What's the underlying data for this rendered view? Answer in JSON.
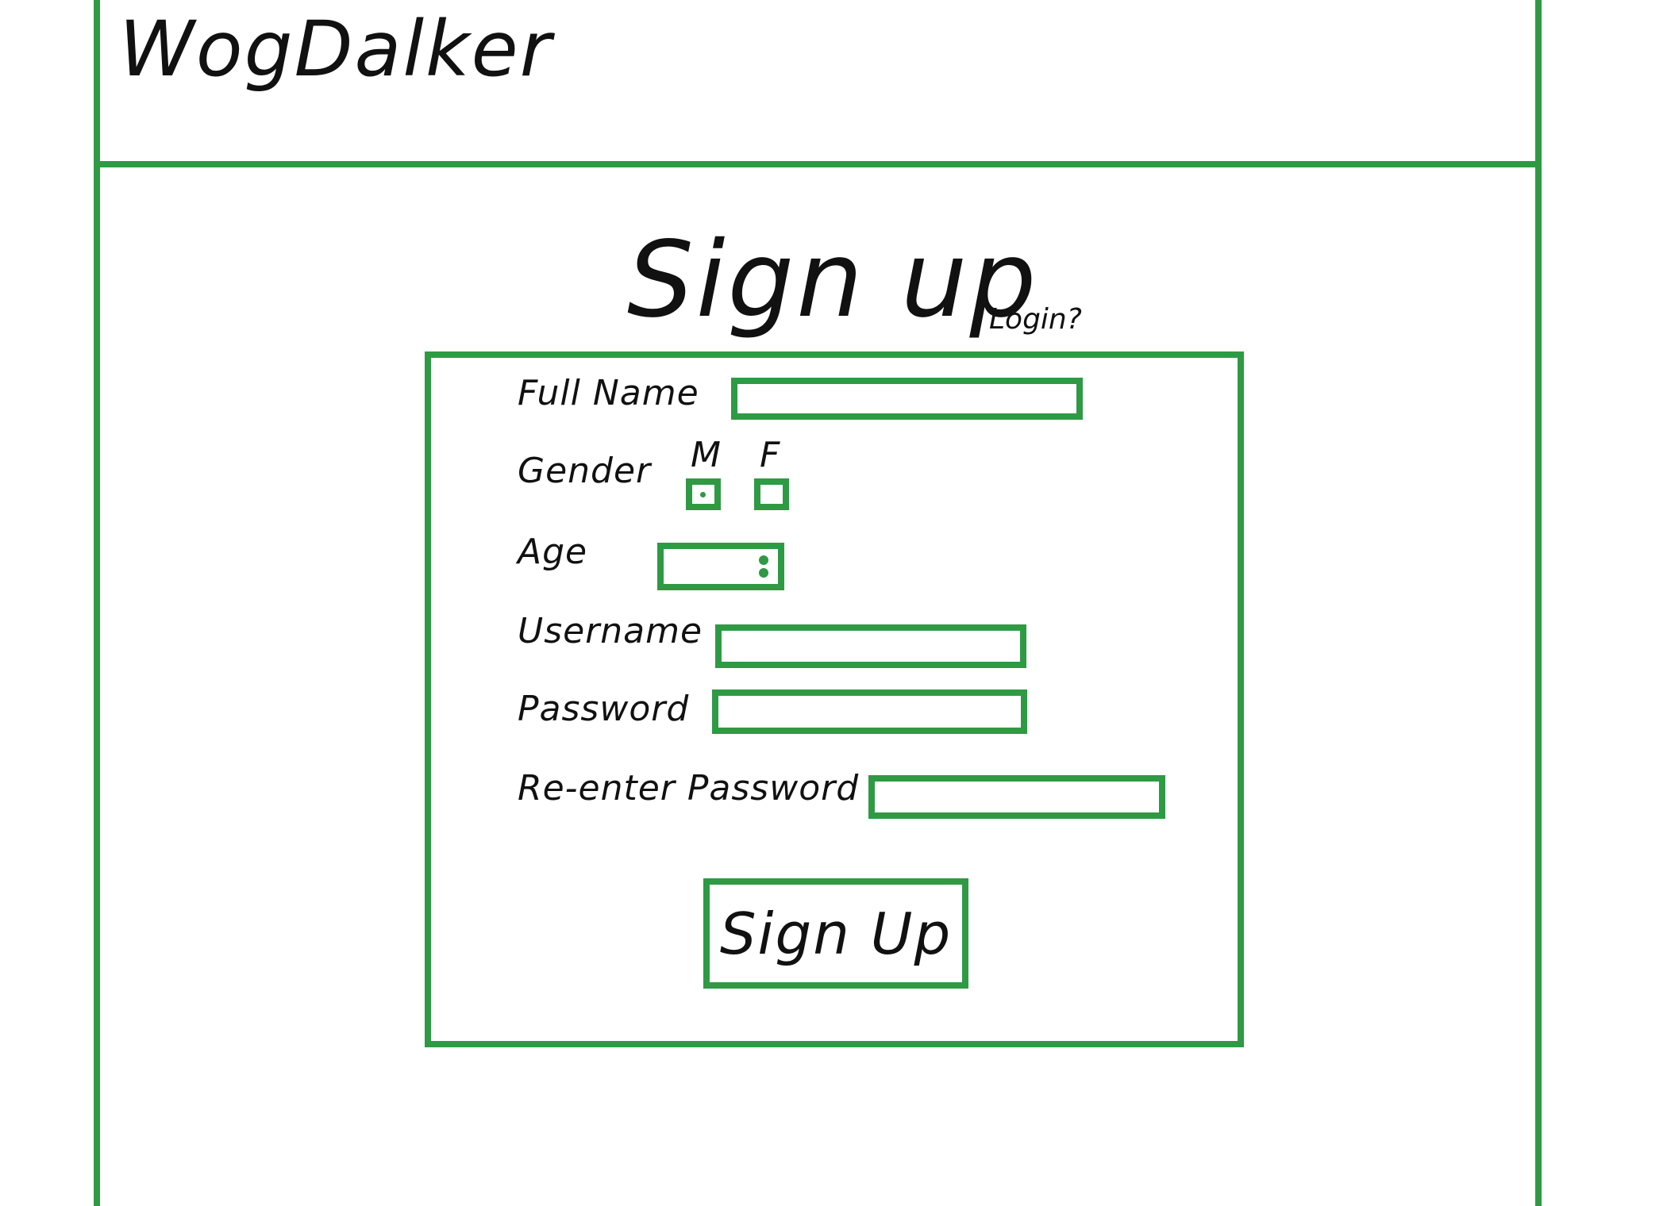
{
  "header": {
    "logo": "WogDalker"
  },
  "page": {
    "title": "Sign up",
    "login_link": "Login?"
  },
  "form": {
    "full_name": {
      "label": "Full Name",
      "value": ""
    },
    "gender": {
      "label": "Gender",
      "options": [
        {
          "label": "M",
          "selected": true
        },
        {
          "label": "F",
          "selected": false
        }
      ]
    },
    "age": {
      "label": "Age",
      "value": ""
    },
    "username": {
      "label": "Username",
      "value": ""
    },
    "password": {
      "label": "Password",
      "value": ""
    },
    "reenter_password": {
      "label": "Re-enter Password",
      "value": ""
    },
    "submit_label": "Sign Up"
  },
  "colors": {
    "accent": "#2e9a44",
    "text": "#111111",
    "background": "#ffffff"
  }
}
